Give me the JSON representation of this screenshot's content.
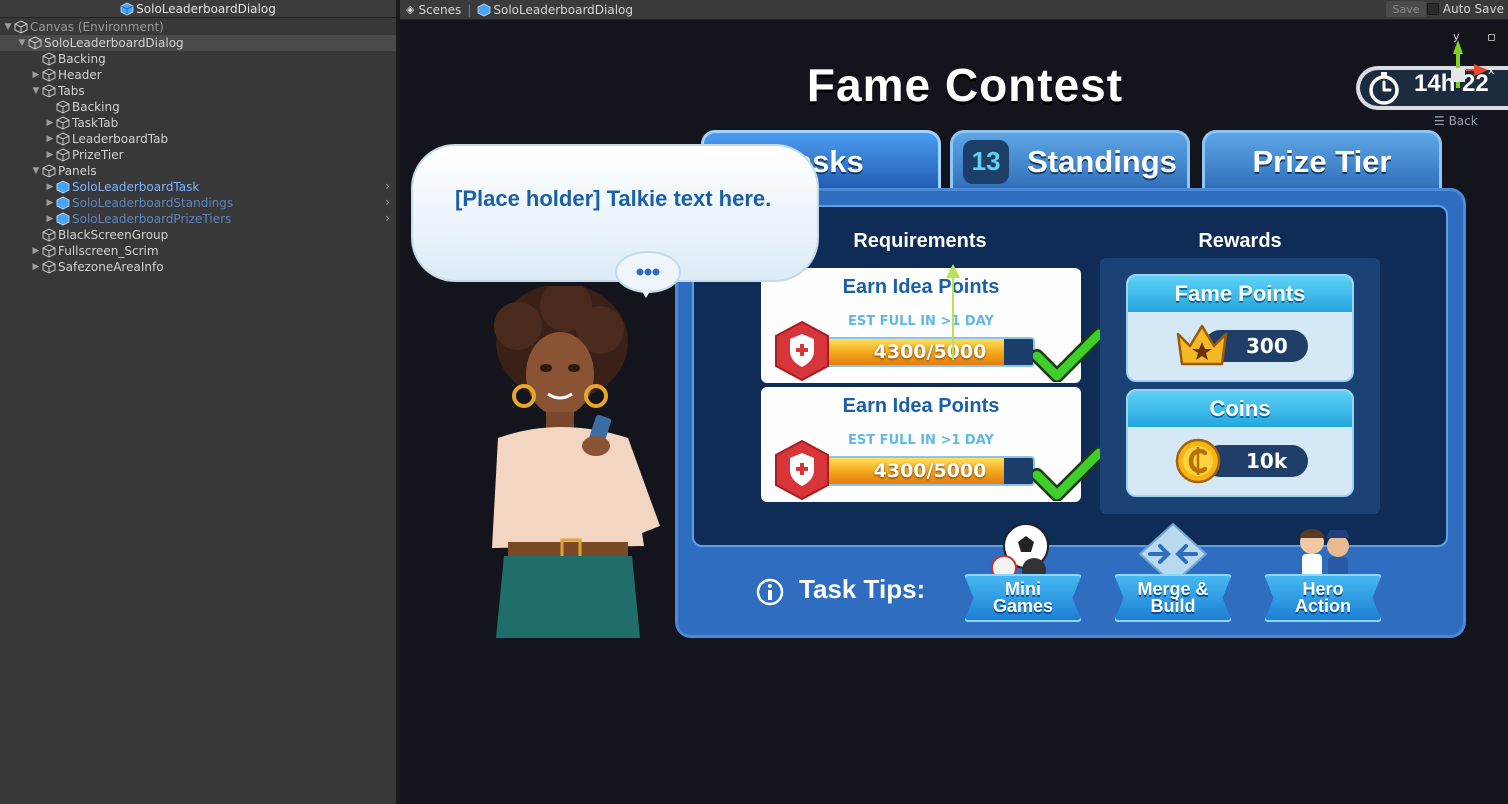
{
  "hierarchy": {
    "title": "SoloLeaderboardDialog",
    "items": [
      {
        "label": "Canvas (Environment)",
        "indent": 0,
        "fold": "open",
        "style": "dim"
      },
      {
        "label": "SoloLeaderboardDialog",
        "indent": 1,
        "fold": "open",
        "style": "sel"
      },
      {
        "label": "Backing",
        "indent": 2,
        "fold": "",
        "style": ""
      },
      {
        "label": "Header",
        "indent": 2,
        "fold": "closed",
        "style": ""
      },
      {
        "label": "Tabs",
        "indent": 2,
        "fold": "open",
        "style": ""
      },
      {
        "label": "Backing",
        "indent": 3,
        "fold": "",
        "style": ""
      },
      {
        "label": "TaskTab",
        "indent": 3,
        "fold": "closed",
        "style": ""
      },
      {
        "label": "LeaderboardTab",
        "indent": 3,
        "fold": "closed",
        "style": ""
      },
      {
        "label": "PrizeTier",
        "indent": 3,
        "fold": "closed",
        "style": ""
      },
      {
        "label": "Panels",
        "indent": 2,
        "fold": "open",
        "style": ""
      },
      {
        "label": "SoloLeaderboardTask",
        "indent": 3,
        "fold": "closed",
        "style": "blue",
        "chevron": true
      },
      {
        "label": "SoloLeaderboardStandings",
        "indent": 3,
        "fold": "closed",
        "style": "blue-dim",
        "chevron": true
      },
      {
        "label": "SoloLeaderboardPrizeTiers",
        "indent": 3,
        "fold": "closed",
        "style": "blue-dim",
        "chevron": true
      },
      {
        "label": "BlackScreenGroup",
        "indent": 2,
        "fold": "",
        "style": ""
      },
      {
        "label": "Fullscreen_Scrim",
        "indent": 2,
        "fold": "closed",
        "style": ""
      },
      {
        "label": "SafezoneAreaInfo",
        "indent": 2,
        "fold": "closed",
        "style": ""
      }
    ]
  },
  "scene_bar": {
    "scenes_label": "Scenes",
    "prefab_label": "SoloLeaderboardDialog",
    "save_label": "Save",
    "autosave_label": "Auto Save"
  },
  "game": {
    "title": "Fame Contest",
    "timer": "14h 22",
    "back_label": "Back",
    "gizmo_y": "y",
    "gizmo_x": "x",
    "tabs": [
      {
        "label": "Tasks",
        "badge": ""
      },
      {
        "label": "Standings",
        "badge": "13"
      },
      {
        "label": "Prize Tier",
        "badge": ""
      }
    ],
    "requirements_header": "Requirements",
    "rewards_header": "Rewards",
    "requirements": [
      {
        "title": "Earn Idea Points",
        "est": "EST FULL IN >1 DAY",
        "progress_text": "4300/5000",
        "progress": 0.86
      },
      {
        "title": "Earn Idea Points",
        "est": "EST FULL IN >1 DAY",
        "progress_text": "4300/5000",
        "progress": 0.86
      }
    ],
    "rewards": [
      {
        "title": "Fame Points",
        "value": "300",
        "icon": "crown-icon"
      },
      {
        "title": "Coins",
        "value": "10k",
        "icon": "coin-icon"
      }
    ],
    "tips_label": "Task Tips:",
    "tip_buttons": [
      {
        "label": "Mini\nGames",
        "icon": "ball-icon"
      },
      {
        "label": "Merge &\nBuild",
        "icon": "merge-icon"
      },
      {
        "label": "Hero\nAction",
        "icon": "heroes-icon"
      }
    ],
    "bubble_text": "[Place holder] Talkie text here.",
    "colors": {
      "accent_blue": "#2f6dc0",
      "panel_dark": "#0e2c55",
      "progress_orange": "#f4a51a",
      "check_green": "#3fcf2a"
    }
  }
}
